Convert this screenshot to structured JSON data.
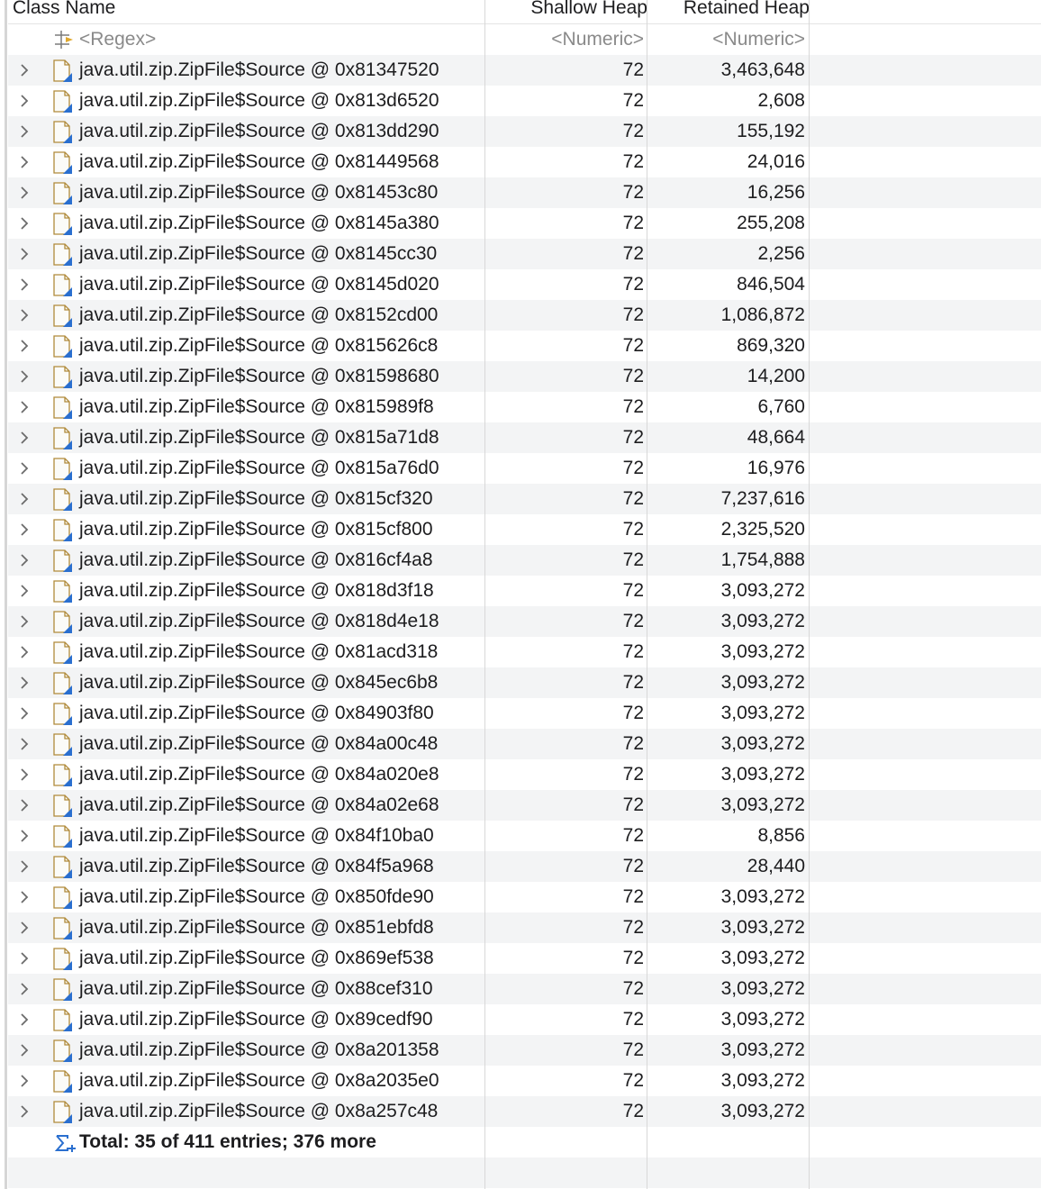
{
  "columns": {
    "class_name": "Class Name",
    "shallow_heap": "Shallow Heap",
    "retained_heap": "Retained Heap"
  },
  "filter_row": {
    "icon": "regex-filter-icon",
    "name": "<Regex>",
    "shallow": "<Numeric>",
    "retained": "<Numeric>"
  },
  "rows": [
    {
      "name": "java.util.zip.ZipFile$Source @ 0x81347520",
      "shallow": "72",
      "retained": "3,463,648"
    },
    {
      "name": "java.util.zip.ZipFile$Source @ 0x813d6520",
      "shallow": "72",
      "retained": "2,608"
    },
    {
      "name": "java.util.zip.ZipFile$Source @ 0x813dd290",
      "shallow": "72",
      "retained": "155,192"
    },
    {
      "name": "java.util.zip.ZipFile$Source @ 0x81449568",
      "shallow": "72",
      "retained": "24,016"
    },
    {
      "name": "java.util.zip.ZipFile$Source @ 0x81453c80",
      "shallow": "72",
      "retained": "16,256"
    },
    {
      "name": "java.util.zip.ZipFile$Source @ 0x8145a380",
      "shallow": "72",
      "retained": "255,208"
    },
    {
      "name": "java.util.zip.ZipFile$Source @ 0x8145cc30",
      "shallow": "72",
      "retained": "2,256"
    },
    {
      "name": "java.util.zip.ZipFile$Source @ 0x8145d020",
      "shallow": "72",
      "retained": "846,504"
    },
    {
      "name": "java.util.zip.ZipFile$Source @ 0x8152cd00",
      "shallow": "72",
      "retained": "1,086,872"
    },
    {
      "name": "java.util.zip.ZipFile$Source @ 0x815626c8",
      "shallow": "72",
      "retained": "869,320"
    },
    {
      "name": "java.util.zip.ZipFile$Source @ 0x81598680",
      "shallow": "72",
      "retained": "14,200"
    },
    {
      "name": "java.util.zip.ZipFile$Source @ 0x815989f8",
      "shallow": "72",
      "retained": "6,760"
    },
    {
      "name": "java.util.zip.ZipFile$Source @ 0x815a71d8",
      "shallow": "72",
      "retained": "48,664"
    },
    {
      "name": "java.util.zip.ZipFile$Source @ 0x815a76d0",
      "shallow": "72",
      "retained": "16,976"
    },
    {
      "name": "java.util.zip.ZipFile$Source @ 0x815cf320",
      "shallow": "72",
      "retained": "7,237,616"
    },
    {
      "name": "java.util.zip.ZipFile$Source @ 0x815cf800",
      "shallow": "72",
      "retained": "2,325,520"
    },
    {
      "name": "java.util.zip.ZipFile$Source @ 0x816cf4a8",
      "shallow": "72",
      "retained": "1,754,888"
    },
    {
      "name": "java.util.zip.ZipFile$Source @ 0x818d3f18",
      "shallow": "72",
      "retained": "3,093,272"
    },
    {
      "name": "java.util.zip.ZipFile$Source @ 0x818d4e18",
      "shallow": "72",
      "retained": "3,093,272"
    },
    {
      "name": "java.util.zip.ZipFile$Source @ 0x81acd318",
      "shallow": "72",
      "retained": "3,093,272"
    },
    {
      "name": "java.util.zip.ZipFile$Source @ 0x845ec6b8",
      "shallow": "72",
      "retained": "3,093,272"
    },
    {
      "name": "java.util.zip.ZipFile$Source @ 0x84903f80",
      "shallow": "72",
      "retained": "3,093,272"
    },
    {
      "name": "java.util.zip.ZipFile$Source @ 0x84a00c48",
      "shallow": "72",
      "retained": "3,093,272"
    },
    {
      "name": "java.util.zip.ZipFile$Source @ 0x84a020e8",
      "shallow": "72",
      "retained": "3,093,272"
    },
    {
      "name": "java.util.zip.ZipFile$Source @ 0x84a02e68",
      "shallow": "72",
      "retained": "3,093,272"
    },
    {
      "name": "java.util.zip.ZipFile$Source @ 0x84f10ba0",
      "shallow": "72",
      "retained": "8,856"
    },
    {
      "name": "java.util.zip.ZipFile$Source @ 0x84f5a968",
      "shallow": "72",
      "retained": "28,440"
    },
    {
      "name": "java.util.zip.ZipFile$Source @ 0x850fde90",
      "shallow": "72",
      "retained": "3,093,272"
    },
    {
      "name": "java.util.zip.ZipFile$Source @ 0x851ebfd8",
      "shallow": "72",
      "retained": "3,093,272"
    },
    {
      "name": "java.util.zip.ZipFile$Source @ 0x869ef538",
      "shallow": "72",
      "retained": "3,093,272"
    },
    {
      "name": "java.util.zip.ZipFile$Source @ 0x88cef310",
      "shallow": "72",
      "retained": "3,093,272"
    },
    {
      "name": "java.util.zip.ZipFile$Source @ 0x89cedf90",
      "shallow": "72",
      "retained": "3,093,272"
    },
    {
      "name": "java.util.zip.ZipFile$Source @ 0x8a201358",
      "shallow": "72",
      "retained": "3,093,272"
    },
    {
      "name": "java.util.zip.ZipFile$Source @ 0x8a2035e0",
      "shallow": "72",
      "retained": "3,093,272"
    },
    {
      "name": "java.util.zip.ZipFile$Source @ 0x8a257c48",
      "shallow": "72",
      "retained": "3,093,272"
    }
  ],
  "total_row": {
    "icon": "sum-icon",
    "label": "Total: 35 of 411 entries; 376 more"
  },
  "icons": {
    "row_expander": "chevron-right-icon",
    "object": "object-instance-icon"
  },
  "colors": {
    "alt_row": "#f3f4f5",
    "icon_accent": "#2a6fcf",
    "icon_body": "#c9a24a"
  }
}
